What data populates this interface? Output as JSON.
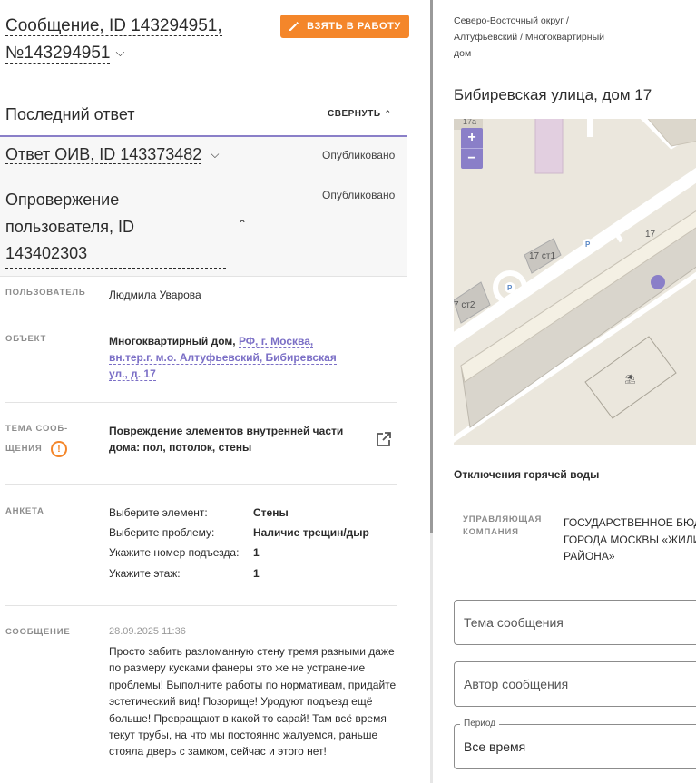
{
  "header": {
    "title_line1": "Сообщение, ID 143294951,",
    "title_line2": "№143294951",
    "take_button": "ВЗЯТЬ В РАБОТУ"
  },
  "last_answer": {
    "title": "Последний ответ",
    "collapse_label": "СВЕРНУТЬ"
  },
  "responses": [
    {
      "title": "Ответ ОИВ, ID 143373482",
      "status": "Опубликовано"
    },
    {
      "title_lines": [
        "Опровержение",
        "пользователя, ID",
        "143402303"
      ],
      "status": "Опубликовано"
    }
  ],
  "details": {
    "user_label": "ПОЛЬЗОВАТЕЛЬ",
    "user_value": "Людмила Уварова",
    "object_label": "ОБЪЕКТ",
    "object_prefix": "Многоквартирный дом,",
    "object_link_lines": [
      "РФ, г. Москва,",
      "вн.тер.г. м.о. Алтуфьевский, Бибиревская",
      "ул., д. 17"
    ],
    "topic_label_lines": [
      "ТЕМА СООБ-",
      "ЩЕНИЯ"
    ],
    "topic_value_lines": [
      "Повреждение элементов внутренней части",
      "дома: пол, потолок, стены"
    ],
    "survey_label": "АНКЕТА",
    "survey": [
      {
        "key": "Выберите элемент:",
        "value": "Стены"
      },
      {
        "key": "Выберите проблему:",
        "value": "Наличие трещин/дыр"
      },
      {
        "key": "Укажите номер подъезда:",
        "value": "1"
      },
      {
        "key": "Укажите этаж:",
        "value": "1"
      }
    ],
    "message_label": "СООБЩЕНИЕ",
    "message_date": "28.09.2025 11:36",
    "message_text": "Просто забить разломанную стену тремя разными даже по размеру кусками фанеры это же не устранение проблемы! Выполните работы по нормативам, придайте эстетический вид! Позорище! Уродуют подъезд ещё больше! Превращают в какой то сарай! Там всё время текут трубы, на что мы постоянно жалуемся, раньше стояла дверь с замком, сейчас и этого нет!"
  },
  "right": {
    "breadcrumbs_lines": [
      "Северо-Восточный округ /",
      "Алтуфьевский / Многоквартирный",
      "дом"
    ],
    "address": "Бибиревская улица, дом 17",
    "map": {
      "zoom_in": "+",
      "zoom_out": "−",
      "labels": [
        "17а",
        "17 ст1",
        "17",
        "7 ст2",
        "P",
        "P"
      ]
    },
    "hot_water": "Отключения горячей воды",
    "management_label_lines": [
      "УПРАВЛЯЮЩАЯ",
      "КОМПАНИЯ"
    ],
    "management_value_lines": [
      "ГОСУДАРСТВЕННОЕ БЮДЖ",
      "ГОРОДА МОСКВЫ «ЖИЛИ",
      "РАЙОНА»"
    ],
    "field_topic_placeholder": "Тема сообщения",
    "field_author_placeholder": "Автор сообщения",
    "period_legend": "Период",
    "period_value": "Все время"
  },
  "colors": {
    "accent": "#8a7fc8",
    "orange": "#f4862a",
    "link": "#7b6fc6"
  }
}
